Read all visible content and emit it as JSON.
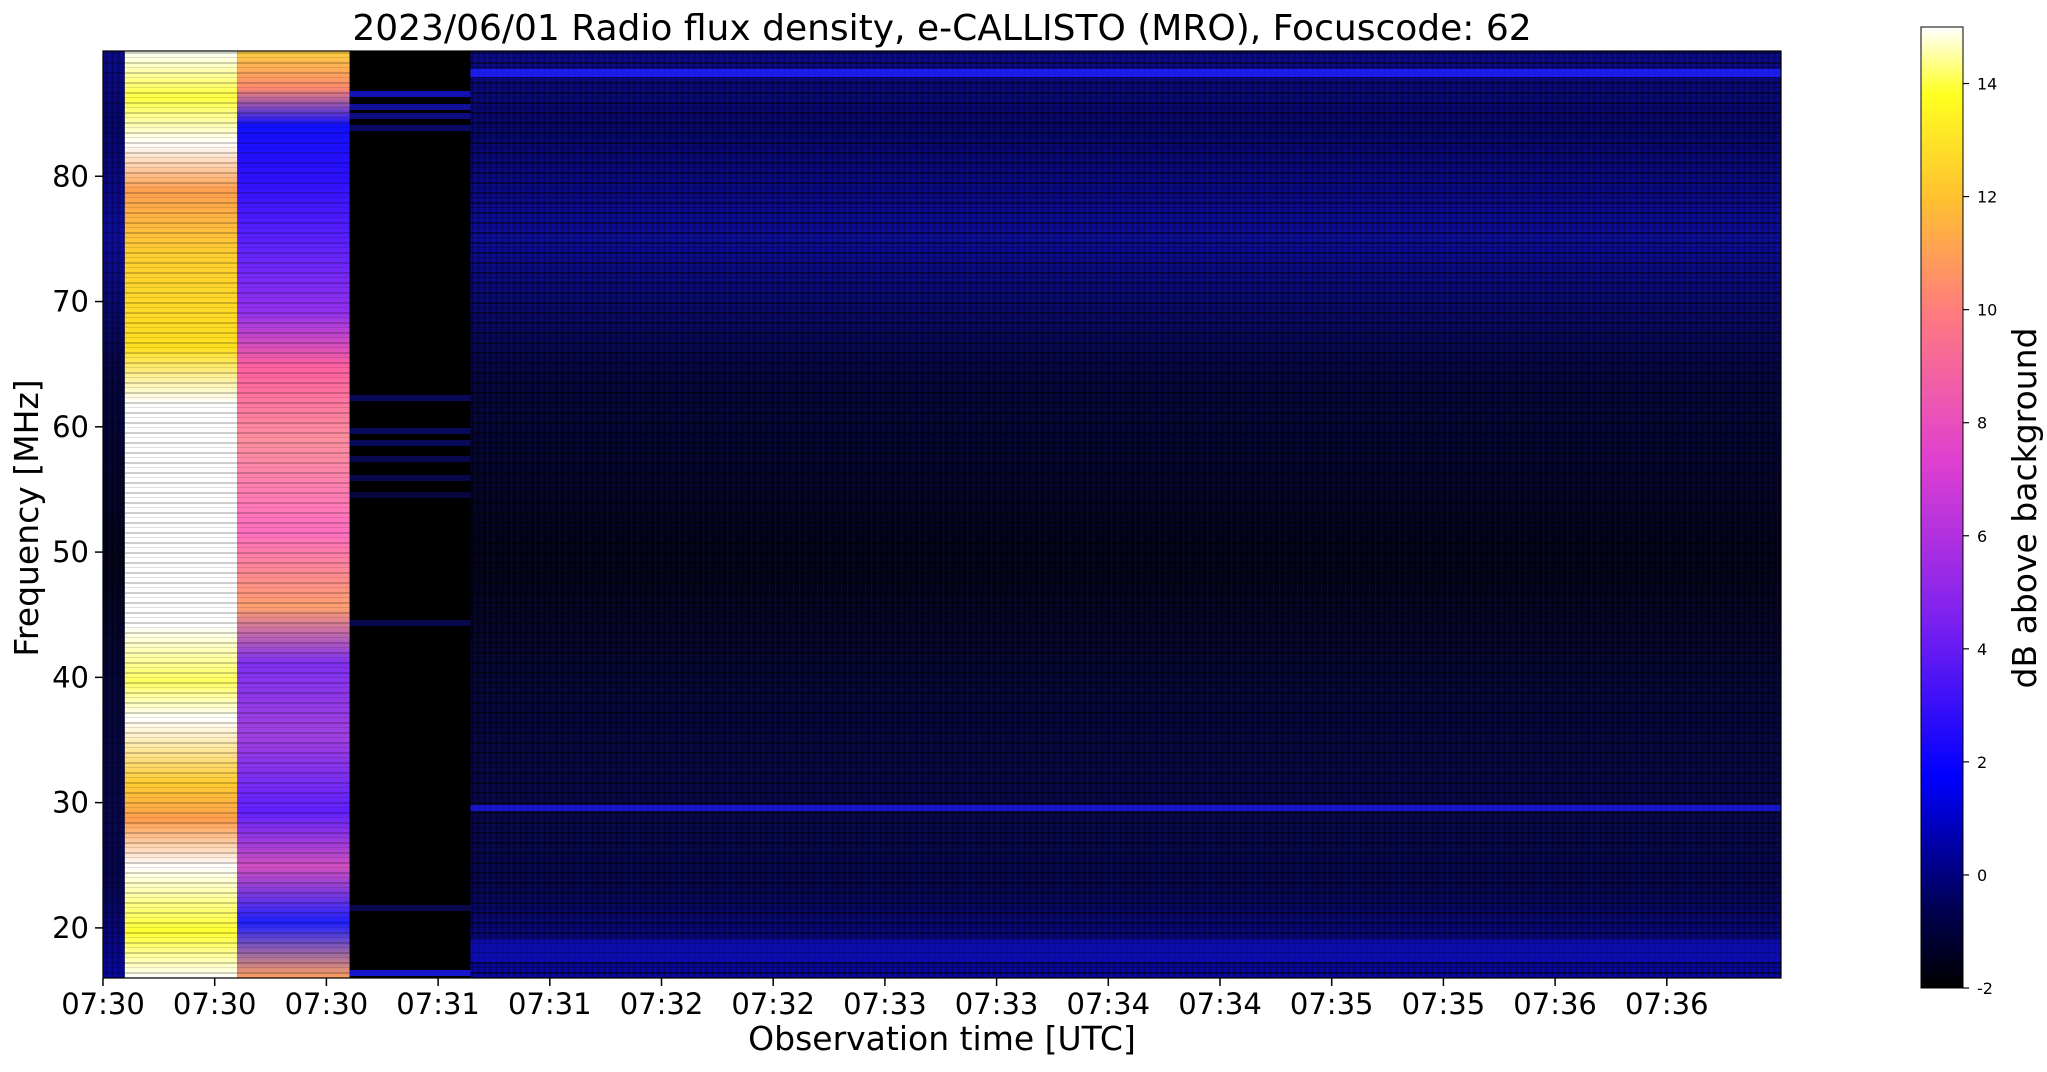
{
  "chart_data": {
    "type": "heatmap",
    "title": "2023/06/01  Radio flux density, e-CALLISTO (MRO), Focuscode: 62",
    "xlabel": "Observation time [UTC]",
    "ylabel": "Frequency [MHz]",
    "x_tick_labels": [
      "07:30",
      "07:30",
      "07:30",
      "07:31",
      "07:31",
      "07:32",
      "07:32",
      "07:33",
      "07:33",
      "07:34",
      "07:34",
      "07:35",
      "07:35",
      "07:36",
      "07:36"
    ],
    "y_ticks": [
      20,
      30,
      40,
      50,
      60,
      70,
      80
    ],
    "ylim": [
      16,
      90
    ],
    "colorbar": {
      "label": "dB above background",
      "ticks": [
        -2,
        0,
        2,
        4,
        6,
        8,
        10,
        12,
        14
      ],
      "range": [
        -2,
        15
      ],
      "colormap": "gnuplot2",
      "stops": [
        "#000000",
        "#0000ff",
        "#8a2be2",
        "#ff4fa0",
        "#ffb040",
        "#ffff00",
        "#ffffff"
      ]
    },
    "segments": [
      {
        "x_from": 0.0,
        "x_to": 0.013,
        "level_db": -0.5
      },
      {
        "x_from": 0.013,
        "x_to": 0.08,
        "level_db": 14.5
      },
      {
        "x_from": 0.08,
        "x_to": 0.147,
        "level_db": 7.5
      },
      {
        "x_from": 0.147,
        "x_to": 0.219,
        "level_db": -1.8
      },
      {
        "x_from": 0.219,
        "x_to": 1.0,
        "level_db": -0.8
      }
    ],
    "grid": false
  }
}
